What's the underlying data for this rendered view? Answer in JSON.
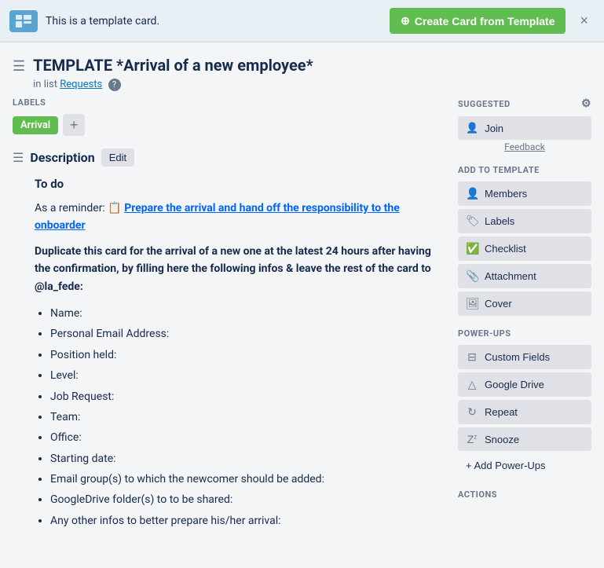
{
  "banner": {
    "text": "This is a template card.",
    "create_btn_label": "Create Card from Template",
    "close_label": "×"
  },
  "card": {
    "title": "TEMPLATE *Arrival of a new employee*",
    "list_prefix": "in list",
    "list_name": "Requests",
    "help_icon": "?"
  },
  "labels_section": {
    "heading": "LABELS",
    "label_text": "Arrival",
    "add_label_icon": "+"
  },
  "description": {
    "heading": "Description",
    "edit_label": "Edit",
    "todo_heading": "To do",
    "reminder_prefix": "As a reminder:",
    "reminder_link": "Prepare the arrival and hand off the responsibility to the onboarder",
    "main_text": "Duplicate this card for the arrival of a new one at the latest 24 hours after having the confirmation, by filling here the following infos & leave the rest of the card to @la_fede:",
    "list_items": [
      "Name:",
      "Personal Email Address:",
      "Position held:",
      "Level:",
      "Job Request:",
      "Team:",
      "Office:",
      "Starting date:",
      "Email group(s) to which the newcomer should be added:",
      "GoogleDrive folder(s) to to be shared:",
      "Any other infos to better prepare his/her arrival:"
    ]
  },
  "sidebar": {
    "suggested_label": "SUGGESTED",
    "join_label": "Join",
    "feedback_label": "Feedback",
    "add_to_template_label": "ADD TO TEMPLATE",
    "add_to_template_items": [
      {
        "icon": "👤",
        "label": "Members"
      },
      {
        "icon": "🏷",
        "label": "Labels"
      },
      {
        "icon": "✅",
        "label": "Checklist"
      },
      {
        "icon": "📎",
        "label": "Attachment"
      },
      {
        "icon": "🖼",
        "label": "Cover"
      }
    ],
    "power_ups_label": "POWER-UPS",
    "power_ups_items": [
      {
        "icon": "🔧",
        "label": "Custom Fields"
      },
      {
        "icon": "△",
        "label": "Google Drive"
      },
      {
        "icon": "↻",
        "label": "Repeat"
      },
      {
        "icon": "Zz",
        "label": "Snooze"
      }
    ],
    "add_power_ups_label": "+ Add Power-Ups",
    "actions_label": "ACTIONS"
  }
}
